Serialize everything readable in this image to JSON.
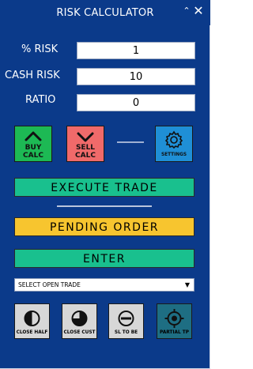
{
  "window": {
    "title": "RISK CALCULATOR",
    "minimize_glyph": "⌃",
    "close_glyph": "✕"
  },
  "inputs": {
    "risk_percent": {
      "label": "% RISK",
      "value": "1"
    },
    "cash_risk": {
      "label": "CASH RISK",
      "value": "10"
    },
    "ratio": {
      "label": "RATIO",
      "value": "0"
    }
  },
  "buttons": {
    "buy_calc": {
      "line1": "BUY",
      "line2": "CALC",
      "icon": "chevron-up-icon"
    },
    "sell_calc": {
      "line1": "SELL",
      "line2": "CALC",
      "icon": "chevron-down-icon"
    },
    "settings": {
      "label": "SETTINGS",
      "icon": "gear-icon"
    },
    "execute_trade": "EXECUTE TRADE",
    "pending_order": "PENDING ORDER",
    "enter": "ENTER"
  },
  "trade_select": {
    "selected": "SELECT OPEN TRADE",
    "arrow": "▼"
  },
  "actions": [
    {
      "label": "CLOSE HALF",
      "icon": "half-circle-icon"
    },
    {
      "label": "CLOSE CUST",
      "icon": "pie-icon"
    },
    {
      "label": "SL TO BE",
      "icon": "minus-circle-icon"
    },
    {
      "label": "PARTIAL TP",
      "icon": "target-icon"
    }
  ],
  "colors": {
    "background": "#0b3a8a",
    "buy": "#1db954",
    "sell": "#f06a6a",
    "settings": "#1f8fd6",
    "execute": "#19c08e",
    "pending": "#f7c52f",
    "partial_tp": "#1e6e83"
  }
}
